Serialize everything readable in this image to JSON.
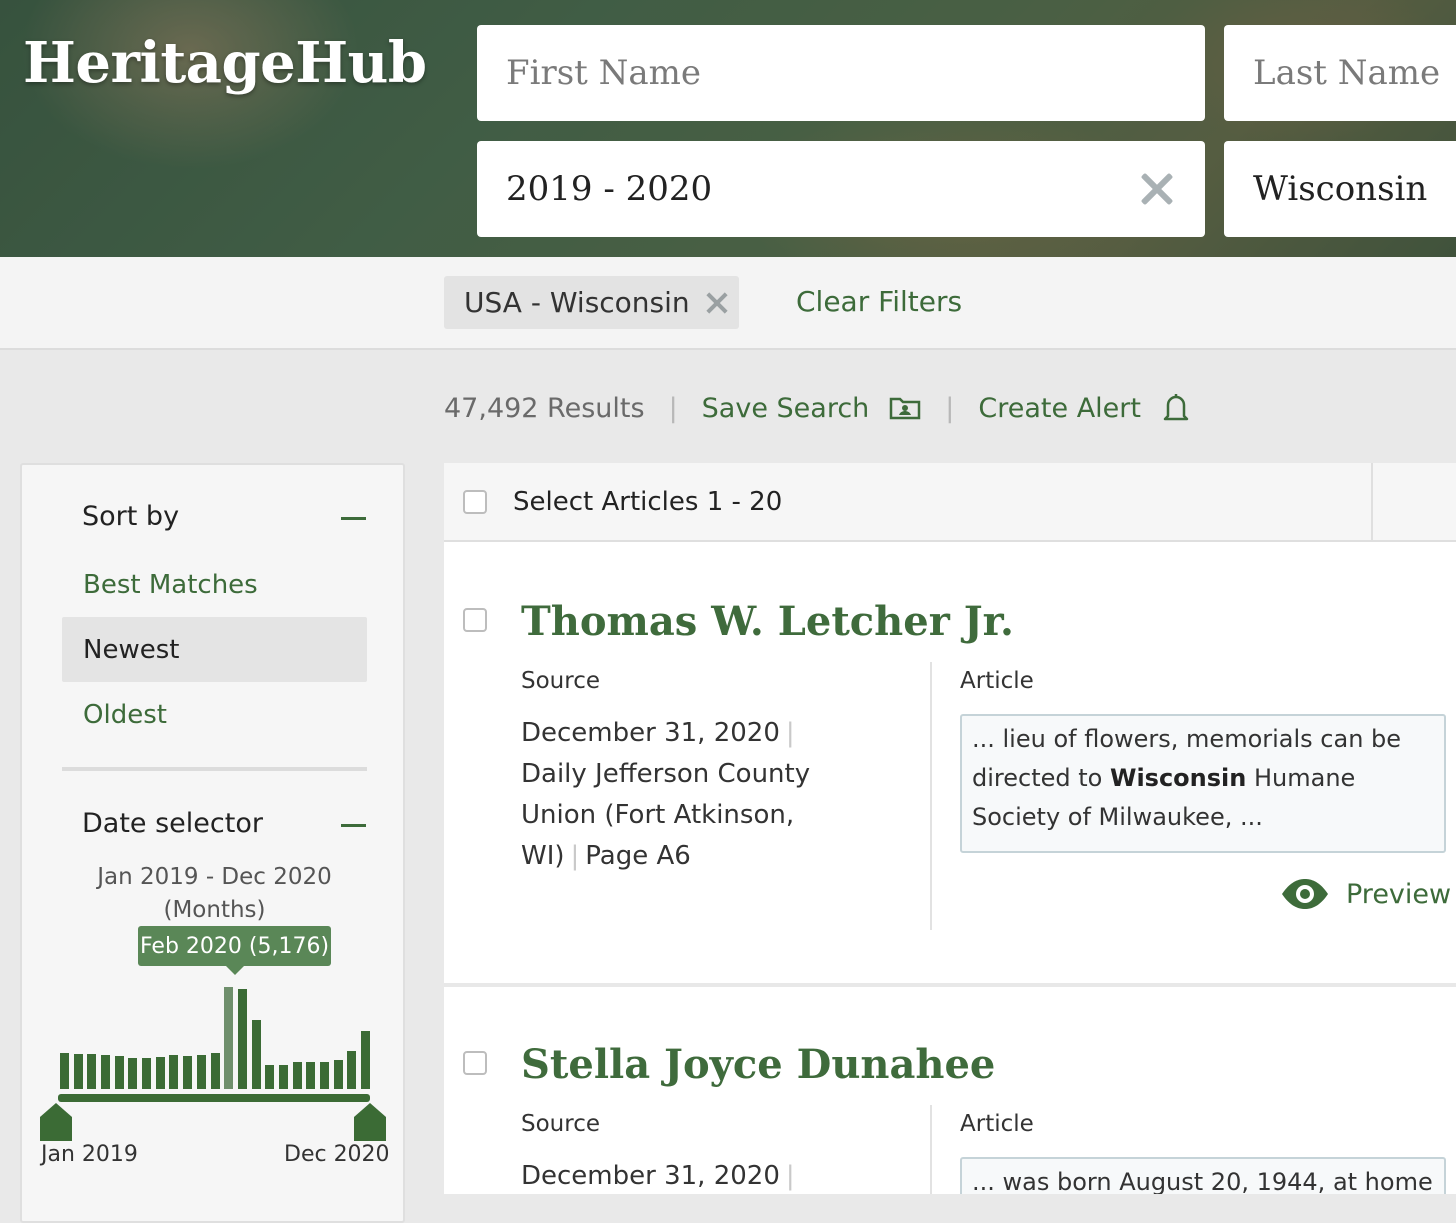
{
  "header": {
    "logo": "HeritageHub",
    "first_name_placeholder": "First Name",
    "last_name_placeholder": "Last Name",
    "date_range_value": "2019 - 2020",
    "location_value": "Wisconsin"
  },
  "filters": {
    "chip_label": "USA - Wisconsin",
    "clear_label": "Clear Filters"
  },
  "results": {
    "count_text": "47,492 Results",
    "save_search_label": "Save Search",
    "create_alert_label": "Create Alert"
  },
  "sidebar": {
    "sort_heading": "Sort by",
    "sort_options": [
      "Best Matches",
      "Newest",
      "Oldest"
    ],
    "selected_sort": "Newest",
    "date_heading": "Date selector",
    "date_range_line1": "Jan 2019 - Dec 2020",
    "date_range_line2": "(Months)",
    "tooltip": "Feb 2020 (5,176)",
    "axis_start": "Jan 2019",
    "axis_end": "Dec 2020",
    "histogram_relative_heights": [
      0.35,
      0.34,
      0.34,
      0.33,
      0.32,
      0.3,
      0.3,
      0.31,
      0.33,
      0.32,
      0.33,
      0.35,
      1.0,
      0.98,
      0.68,
      0.24,
      0.24,
      0.26,
      0.26,
      0.26,
      0.28,
      0.37,
      0.57
    ],
    "histogram_selected_index": 12,
    "colors": {
      "bar": "#3b6b35",
      "bar_selected": "#6f8f6c",
      "accent": "#3d6b3a"
    }
  },
  "list": {
    "select_label": "Select Articles 1 - 20",
    "articles": [
      {
        "name": "Thomas W. Letcher Jr.",
        "source_label": "Source",
        "date": "December 31, 2020",
        "publication": "Daily Jefferson County Union (Fort Atkinson, WI)",
        "page": "Page A6",
        "article_label": "Article",
        "snippet_pre": "... lieu of flowers, memorials can be di­rected to ",
        "snippet_bold": "Wisconsin",
        "snippet_post": " Humane Society of Milwaukee, ...",
        "preview_label": "Preview"
      },
      {
        "name": "Stella Joyce Dunahee",
        "source_label": "Source",
        "date": "December 31, 2020",
        "article_label": "Article",
        "snippet_pre": "... was born August 20, 1944, at home"
      }
    ]
  }
}
